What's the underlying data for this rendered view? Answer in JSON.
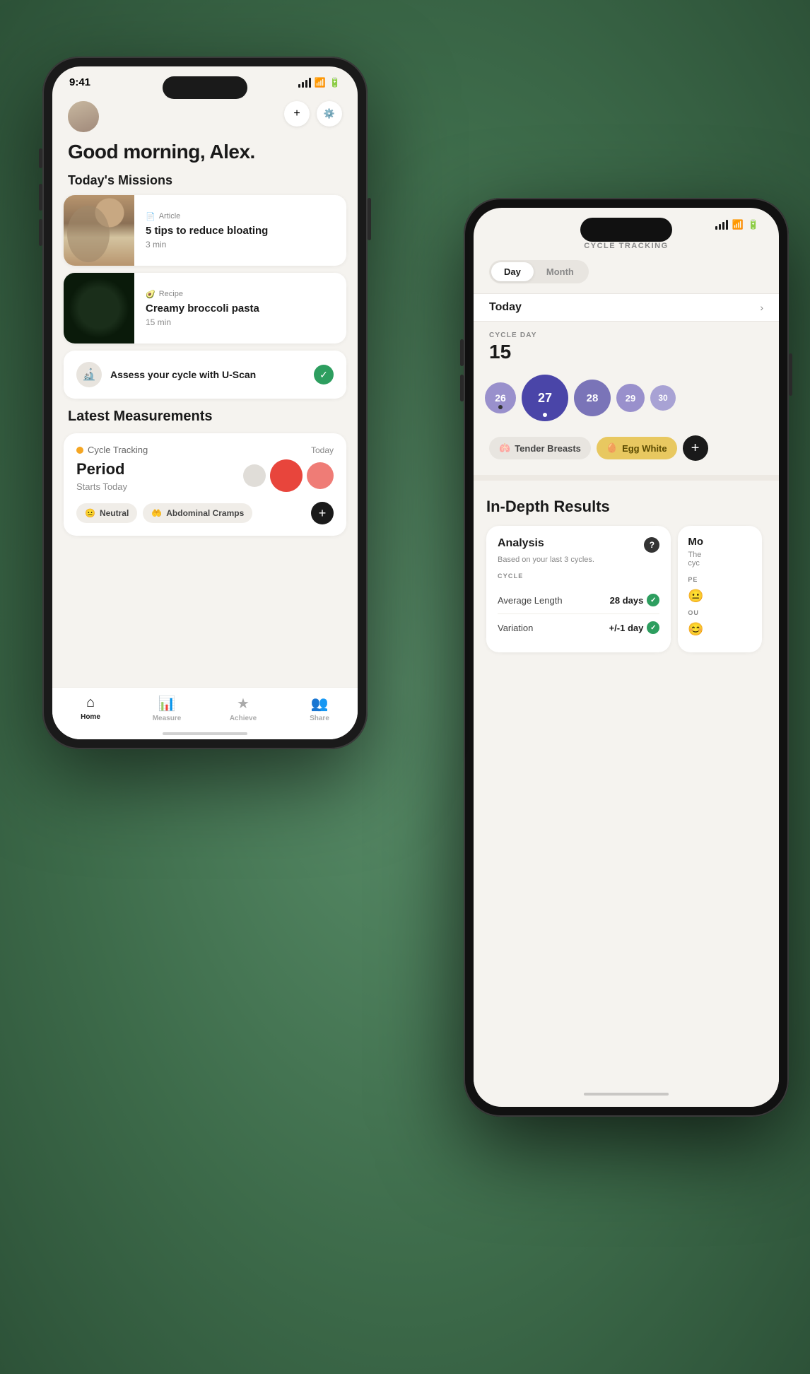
{
  "phone1": {
    "status_bar": {
      "time": "9:41",
      "signal": "●●●",
      "wifi": "wifi",
      "battery": "battery"
    },
    "greeting": "Good morning, Alex.",
    "missions_title": "Today's Missions",
    "missions": [
      {
        "type": "Article",
        "type_icon": "📄",
        "title": "5 tips to reduce bloating",
        "duration": "3 min"
      },
      {
        "type": "Recipe",
        "type_icon": "🥑",
        "title": "Creamy broccoli pasta",
        "duration": "15 min"
      }
    ],
    "uscan": {
      "text": "Assess your cycle with U-Scan",
      "checked": true
    },
    "measurements_title": "Latest Measurements",
    "cycle_tracking": {
      "label": "Cycle Tracking",
      "time": "Today",
      "metric": "Period",
      "sub": "Starts Today"
    },
    "symptoms": [
      {
        "label": "Neutral",
        "icon": "😐"
      },
      {
        "label": "Abdominal Cramps",
        "icon": "🤲"
      }
    ],
    "nav": {
      "items": [
        {
          "label": "Home",
          "icon": "🏠",
          "active": true
        },
        {
          "label": "Measure",
          "icon": "📊",
          "active": false
        },
        {
          "label": "Achieve",
          "icon": "⭐",
          "active": false
        },
        {
          "label": "Share",
          "icon": "👥",
          "active": false
        }
      ]
    }
  },
  "phone2": {
    "status_bar": {
      "time": "",
      "signal": "signal",
      "wifi": "wifi",
      "battery": "battery"
    },
    "header_title": "CYCLE TRACKING",
    "day_month_toggle": {
      "day": "Day",
      "month": "Month",
      "active": "Day"
    },
    "today_row": {
      "label": "Today",
      "has_chevron": true
    },
    "cycle_day": {
      "label": "CYCLE DAY",
      "number": "15"
    },
    "calendar_dots": [
      {
        "num": "26",
        "size": "small"
      },
      {
        "num": "27",
        "size": "large",
        "active": true
      },
      {
        "num": "28",
        "size": "medium"
      },
      {
        "num": "29",
        "size": "small"
      },
      {
        "num": "30",
        "size": "xs"
      }
    ],
    "symptoms": [
      {
        "label": "Tender Breasts",
        "icon": "🫁",
        "style": "gray"
      },
      {
        "label": "Egg White",
        "icon": "🥚",
        "style": "gold"
      }
    ],
    "results": {
      "title": "In-Depth Results",
      "analysis_card": {
        "title": "Analysis",
        "subtitle": "Based on your last 3 cycles.",
        "cycle_label": "CYCLE",
        "stats": [
          {
            "label": "Average Length",
            "value": "28 days",
            "check": true
          },
          {
            "label": "Variation",
            "value": "+/-1 day",
            "check": true
          }
        ]
      },
      "side_card_title": "Mo",
      "side_card_body": "The cyc",
      "side_per": "PE",
      "side_out": "OU"
    }
  }
}
